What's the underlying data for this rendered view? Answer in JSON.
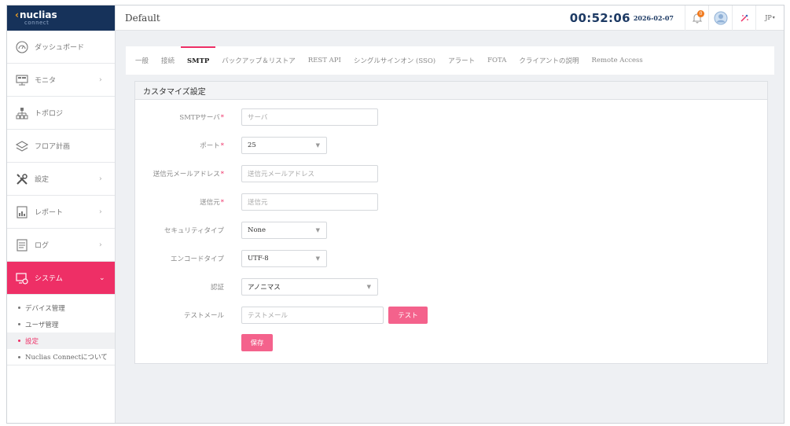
{
  "app": {
    "logo_text": "nuclias",
    "logo_subtext": "connect",
    "site_name": "Default",
    "clock": "00:52:06",
    "date": "2026-02-07",
    "notification_count": "0",
    "language": "JP"
  },
  "sidebar": {
    "items": [
      {
        "label": "ダッシュボード",
        "icon": "dashboard-icon",
        "has_arrow": false
      },
      {
        "label": "モニタ",
        "icon": "monitor-icon",
        "has_arrow": true
      },
      {
        "label": "トポロジ",
        "icon": "topology-icon",
        "has_arrow": false
      },
      {
        "label": "フロア計画",
        "icon": "floor-plan-icon",
        "has_arrow": false
      },
      {
        "label": "設定",
        "icon": "tools-icon",
        "has_arrow": true
      },
      {
        "label": "レポート",
        "icon": "report-icon",
        "has_arrow": true
      },
      {
        "label": "ログ",
        "icon": "log-icon",
        "has_arrow": true
      },
      {
        "label": "システム",
        "icon": "system-icon",
        "has_arrow": true,
        "active": true
      }
    ],
    "arrow_right": "›",
    "arrow_down": "⌄",
    "sub_items": [
      {
        "label": "デバイス管理"
      },
      {
        "label": "ユーザ管理"
      },
      {
        "label": "設定",
        "current": true
      },
      {
        "label": "Nuclias Connectについて"
      }
    ]
  },
  "tabs": [
    {
      "label": "一般"
    },
    {
      "label": "接続"
    },
    {
      "label": "SMTP",
      "active": true
    },
    {
      "label": "バックアップ＆リストア"
    },
    {
      "label": "REST API"
    },
    {
      "label": "シングルサインオン (SSO)"
    },
    {
      "label": "アラート"
    },
    {
      "label": "FOTA"
    },
    {
      "label": "クライアントの説明"
    },
    {
      "label": "Remote Access"
    }
  ],
  "form": {
    "title": "カスタマイズ設定",
    "smtp_server": {
      "label": "SMTPサーバ",
      "placeholder": "サーバ",
      "required": "*"
    },
    "port": {
      "label": "ポート",
      "value": "25",
      "required": "*"
    },
    "sender_email": {
      "label": "送信元メールアドレス",
      "placeholder": "送信元メールアドレス",
      "required": "*"
    },
    "sender": {
      "label": "送信元",
      "placeholder": "送信元",
      "required": "*"
    },
    "security_type": {
      "label": "セキュリティタイプ",
      "value": "None"
    },
    "encode_type": {
      "label": "エンコードタイプ",
      "value": "UTF-8"
    },
    "auth": {
      "label": "認証",
      "value": "アノニマス"
    },
    "test_mail": {
      "label": "テストメール",
      "placeholder": "テストメール",
      "button": "テスト"
    },
    "save_button": "保存"
  },
  "colors": {
    "accent": "#ee2f66",
    "button": "#f4628c",
    "header_bg": "#16325a",
    "clock": "#1d3a64"
  }
}
